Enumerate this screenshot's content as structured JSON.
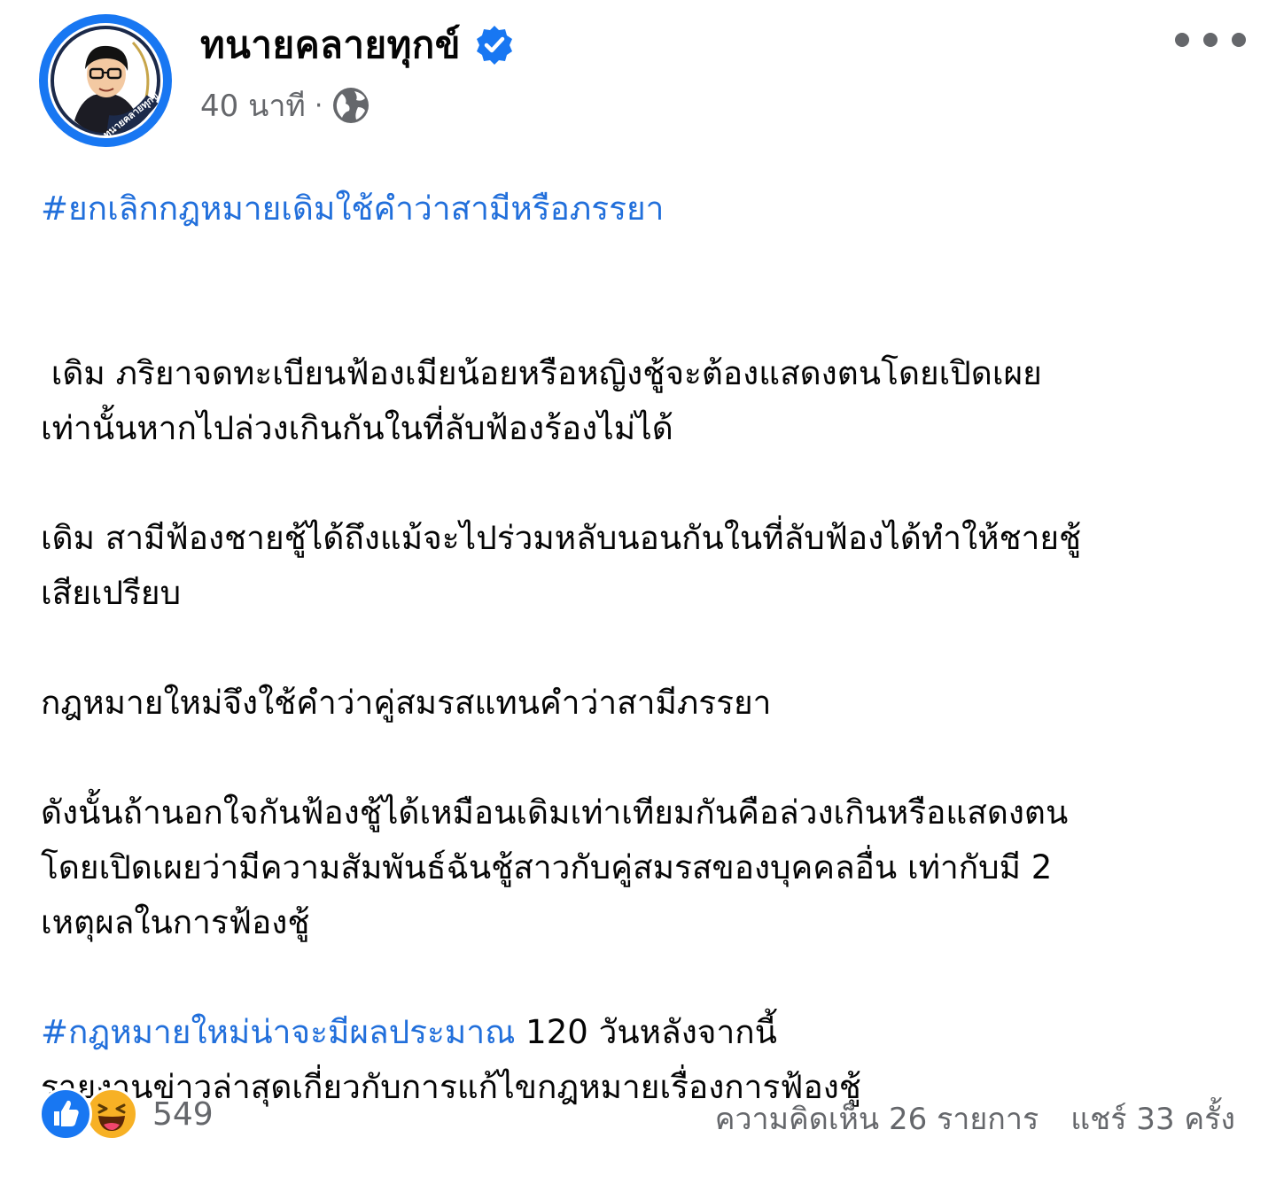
{
  "post": {
    "author_name": "ทนายคลายทุกข์",
    "avatar_text": "ทนายคลายทุกข์",
    "timestamp": "40 นาที",
    "meta_separator": "·",
    "privacy_icon": "globe-icon",
    "verified_icon": "verified-badge-icon",
    "more_icon": "more-options-icon",
    "paragraphs": {
      "p1_hashtag": "#ยกเลิกกฎหมายเดิมใช้คำว่าสามีหรือภรรยา",
      "p2_line1": " เดิม ภริยาจดทะเบียนฟ้องเมียน้อยหรือหญิงชู้จะต้องแสดงตนโดยเปิดเผย",
      "p2_line2": "เท่านั้นหากไปล่วงเกินกันในที่ลับฟ้องร้องไม่ได้",
      "p3_line1": "เดิม สามีฟ้องชายชู้ได้ถึงแม้จะไปร่วมหลับนอนกันในที่ลับฟ้องได้ทำให้ชายชู้",
      "p3_line2": "เสียเปรียบ",
      "p4_line1": "กฎหมายใหม่จึงใช้คำว่าคู่สมรสแทนคำว่าสามีภรรยา",
      "p5_line1": "ดังนั้นถ้านอกใจกันฟ้องชู้ได้เหมือนเดิมเท่าเทียมกันคือล่วงเกินหรือแสดงตน",
      "p5_line2": "โดยเปิดเผยว่ามีความสัมพันธ์ฉันชู้สาวกับคู่สมรสของบุคคลอื่น เท่ากับมี 2",
      "p5_line3": "เหตุผลในการฟ้องชู้",
      "p6_hashtag": "#กฎหมายใหม่น่าจะมีผลประมาณ",
      "p6_rest": " 120 วันหลังจากนี้",
      "p6_line2": "รายงานข่าวล่าสุดเกี่ยวกับการแก้ไขกฎหมายเรื่องการฟ้องชู้"
    }
  },
  "footer": {
    "reaction_icons": [
      "like-icon",
      "haha-icon"
    ],
    "reaction_count": "549",
    "comments": "ความคิดเห็น 26 รายการ",
    "shares": "แชร์ 33 ครั้ง"
  },
  "colors": {
    "accent": "#1877f2",
    "hashtag": "#216fdb",
    "secondary_text": "#65676b",
    "text": "#050505",
    "haha": "#f7b125"
  }
}
